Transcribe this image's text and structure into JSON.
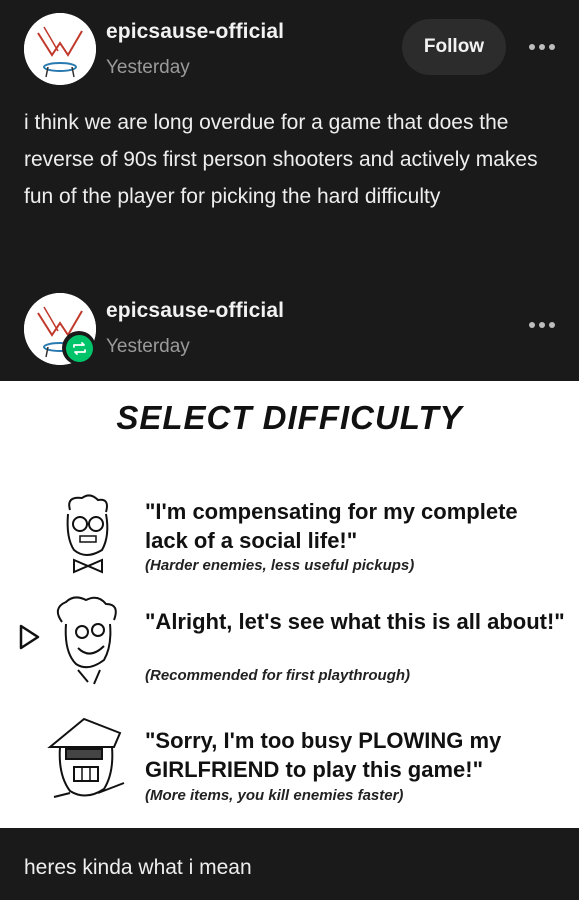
{
  "post": {
    "username": "epicsause-official",
    "timestamp": "Yesterday",
    "follow_label": "Follow",
    "body": "i think we are long overdue for a game that does the reverse of 90s first person shooters and actively makes fun of the player for picking the hard difficulty",
    "icons": {
      "more": "more-horizontal-icon",
      "avatar": "avatar"
    }
  },
  "reblog": {
    "username": "epicsause-official",
    "timestamp": "Yesterday",
    "icons": {
      "badge": "reblog-icon",
      "more": "more-horizontal-icon"
    },
    "badge_color": "#00c46a"
  },
  "image": {
    "title": "SELECT DIFFICULTY",
    "options": [
      {
        "quote": "\"I'm compensating for my complete lack of a social life!\"",
        "note": "(Harder enemies, less useful pickups)",
        "selected": false
      },
      {
        "quote": "\"Alright, let's see what this is all about!\"",
        "note": "(Recommended for first playthrough)",
        "selected": true
      },
      {
        "quote": "\"Sorry, I'm too busy PLOWING my GIRLFRIEND to play this game!\"",
        "note": "(More items, you kill enemies faster)",
        "selected": false
      }
    ],
    "selector_icon": "triangle-cursor-icon"
  },
  "caption": "heres kinda what i mean",
  "colors": {
    "background": "#1a1a1a",
    "panel": "#ffffff",
    "follow_button": "#2c2c2c"
  }
}
